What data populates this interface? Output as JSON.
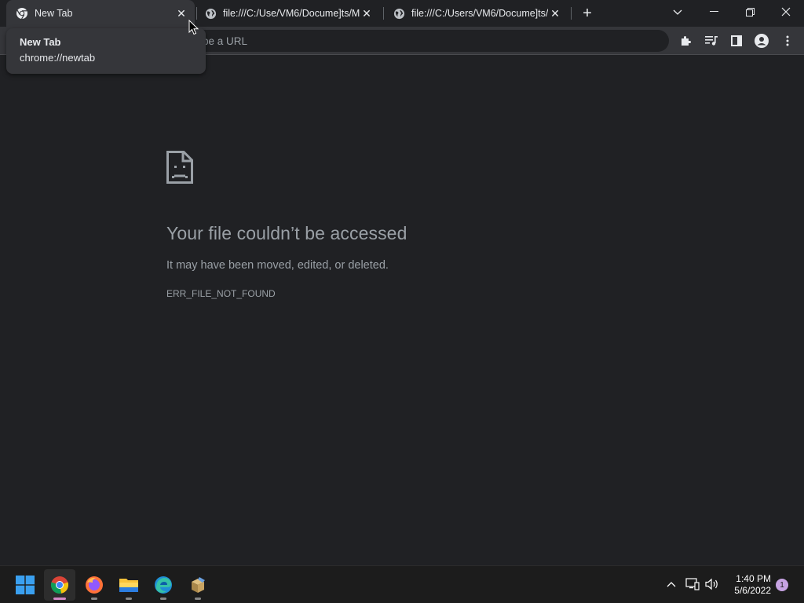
{
  "tabs": [
    {
      "title": "New Tab",
      "icon": "chrome-icon",
      "active": true
    },
    {
      "title": "file:///C:/Use/VM6/Docume]ts/M",
      "icon": "globe-icon",
      "active": false
    },
    {
      "title": "file:///C:/Users/VM6/Docume]ts/",
      "icon": "globe-icon",
      "active": false
    }
  ],
  "new_tab_symbol": "+",
  "omnibox": {
    "placeholder": "pe a URL"
  },
  "hovercard": {
    "title": "New Tab",
    "url": "chrome://newtab"
  },
  "error": {
    "title": "Your file couldn’t be accessed",
    "description": "It may have been moved, edited, or deleted.",
    "code": "ERR_FILE_NOT_FOUND"
  },
  "taskbar": {
    "apps": [
      "windows-start-icon",
      "chrome-icon",
      "firefox-icon",
      "file-explorer-icon",
      "edge-icon",
      "installer-icon"
    ],
    "clock_time": "1:40 PM",
    "clock_date": "5/6/2022",
    "notification_count": "1"
  },
  "colors": {
    "background": "#202124",
    "toolbar": "#35363a",
    "text_muted": "#9aa0a6",
    "taskbar": "#1c1c1c",
    "active_indicator": "#d38ac7"
  }
}
